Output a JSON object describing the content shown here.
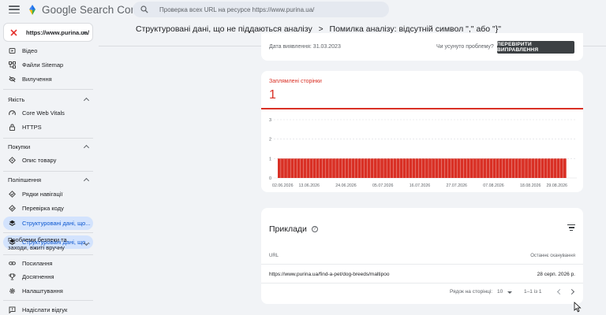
{
  "app": {
    "brand": "Google Search Console",
    "search_placeholder": "Проверка всех URL на ресурсе https://www.purina.ua/"
  },
  "property": {
    "label": "https://www.purina.ua/"
  },
  "sidebar": {
    "items_top": [
      {
        "label": "Відео",
        "icon": "video-icon"
      },
      {
        "label": "Файли Sitemap",
        "icon": "sitemap-icon"
      },
      {
        "label": "Вилучення",
        "icon": "removals-icon"
      }
    ],
    "sections": [
      {
        "title": "Якість",
        "items": [
          {
            "label": "Core Web Vitals",
            "icon": "speedometer-icon"
          },
          {
            "label": "HTTPS",
            "icon": "lock-icon"
          }
        ]
      },
      {
        "title": "Покупки",
        "items": [
          {
            "label": "Опис товару",
            "icon": "tag-icon"
          }
        ]
      },
      {
        "title": "Поліпшення",
        "items": [
          {
            "label": "Рядки навігації",
            "icon": "breadcrumb-icon"
          },
          {
            "label": "Перевірка коду",
            "icon": "code-check-icon"
          },
          {
            "label": "Структуровані дані, що...",
            "icon": "layers-icon",
            "active": true
          }
        ]
      },
      {
        "title": "Проблеми безпеки та заходи, вжиті вручну",
        "items": []
      }
    ],
    "items_bottom": [
      {
        "label": "Посилання",
        "icon": "link-icon"
      },
      {
        "label": "Досягнення",
        "icon": "trophy-icon"
      },
      {
        "label": "Налаштування",
        "icon": "gear-icon"
      },
      {
        "label": "Надіслати відгук",
        "icon": "feedback-icon"
      }
    ]
  },
  "breadcrumb": {
    "parent": "Структуровані дані, що не піддаються аналізу",
    "current": "Помилка аналізу: відсутній символ \",\" або \"}\""
  },
  "status_card": {
    "detected": "Дата виявлення: 31.03.2023",
    "fixed_question": "Чи усунуто проблему?",
    "validate_button": "ПЕРЕВІРИТИ ВИПРАВЛЕННЯ"
  },
  "chart_card": {
    "label": "Заплямлені сторінки",
    "value": "1"
  },
  "chart_data": {
    "type": "bar",
    "title": "",
    "xlabel": "",
    "ylabel": "",
    "ylim": [
      0,
      3
    ],
    "y_ticks": [
      "0",
      "1",
      "2",
      "3"
    ],
    "x_tick_labels": [
      "02.06.2026",
      "13.06.2026",
      "24.06.2026",
      "05.07.2026",
      "16.07.2026",
      "27.07.2026",
      "07.08.2026",
      "18.08.2026",
      "29.08.2026"
    ],
    "bar_value": 1,
    "bar_count": 90,
    "color": "#d93025",
    "grid": true
  },
  "examples": {
    "title": "Приклади",
    "col_url": "URL",
    "col_crawled": "Останнє сканування",
    "rows": [
      {
        "url": "https://www.purina.ua/find-a-pet/dog-breeds/maltipoo",
        "date": "28 серп. 2026 р."
      }
    ],
    "rows_per_page_label": "Рядок на сторінці:",
    "rows_per_page": "10",
    "range": "1–1 із 1"
  }
}
